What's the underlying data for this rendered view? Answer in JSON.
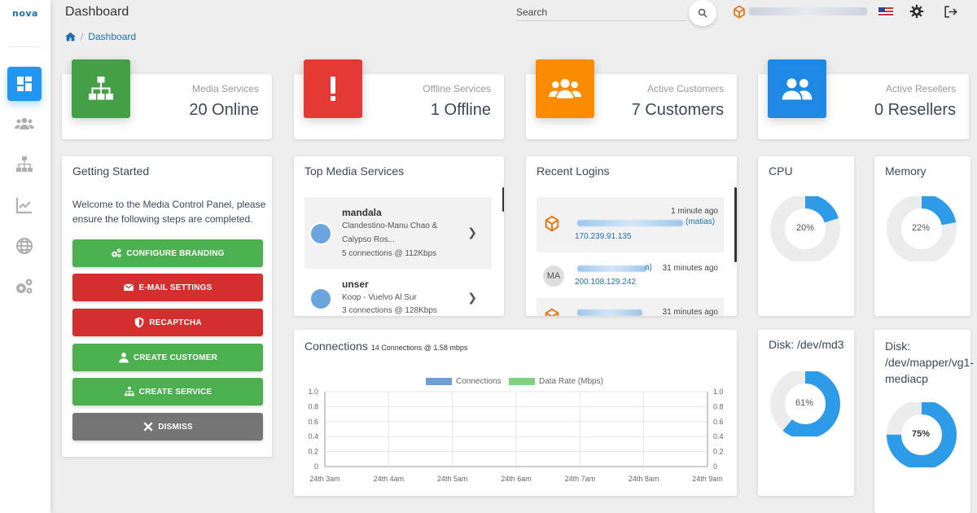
{
  "app": {
    "logo": "nova",
    "page_title": "Dashboard"
  },
  "breadcrumb": {
    "home_icon": "home-icon",
    "current": "Dashboard"
  },
  "header": {
    "search_placeholder": "Search",
    "icons": [
      "search-icon",
      "user-icon",
      "flag-us-icon",
      "gear-icon",
      "logout-icon"
    ]
  },
  "sidebar": {
    "items": [
      {
        "icon": "dashboard-icon",
        "active": true
      },
      {
        "icon": "users-icon",
        "active": false
      },
      {
        "icon": "sitemap-icon",
        "active": false
      },
      {
        "icon": "chart-icon",
        "active": false
      },
      {
        "icon": "globe-icon",
        "active": false
      },
      {
        "icon": "gears-icon",
        "active": false
      }
    ]
  },
  "stats": [
    {
      "label": "Media Services",
      "value": "20 Online",
      "color": "#43a047",
      "icon": "sitemap-icon"
    },
    {
      "label": "Offline Services",
      "value": "1 Offline",
      "color": "#e53935",
      "icon": "exclamation-icon"
    },
    {
      "label": "Active Customers",
      "value": "7 Customers",
      "color": "#fb8c00",
      "icon": "users-icon"
    },
    {
      "label": "Active Resellers",
      "value": "0 Resellers",
      "color": "#1e88e5",
      "icon": "user-group-icon"
    }
  ],
  "getting_started": {
    "title": "Getting Started",
    "text": "Welcome to the Media Control Panel, please ensure the following steps are completed.",
    "buttons": [
      {
        "label": "CONFIGURE BRANDING",
        "color": "#4caf50",
        "icon": "gears-icon"
      },
      {
        "label": "E-MAIL SETTINGS",
        "color": "#d32f2f",
        "icon": "envelope-icon"
      },
      {
        "label": "RECAPTCHA",
        "color": "#d32f2f",
        "icon": "shield-icon"
      },
      {
        "label": "CREATE CUSTOMER",
        "color": "#4caf50",
        "icon": "user-icon"
      },
      {
        "label": "CREATE SERVICE",
        "color": "#4caf50",
        "icon": "sitemap-icon"
      },
      {
        "label": "DISMISS",
        "color": "#757575",
        "icon": "times-icon"
      }
    ]
  },
  "top_media": {
    "title": "Top Media Services",
    "items": [
      {
        "name": "mandala",
        "track_line1": "Clandestino-Manu Chao &",
        "track_line2": "Calypso Ros...",
        "stats": "5 connections @ 112Kbps"
      },
      {
        "name": "unser",
        "track_line1": "Koop - Vuelvo Al Sur",
        "track_line2": "",
        "stats": "3 connections @ 128Kbps"
      }
    ]
  },
  "recent_logins": {
    "title": "Recent Logins",
    "items": [
      {
        "time": "1 minute ago",
        "user_suffix": "(matias)",
        "ip": "170.239.91.135",
        "avatar": "box-icon"
      },
      {
        "time": "31 minutes ago",
        "user_suffix": "a)",
        "ip": "200.108.129.242",
        "avatar": "MA"
      },
      {
        "time": "31 minutes ago",
        "user_suffix": "",
        "ip": "",
        "avatar": "box-icon"
      }
    ]
  },
  "resources": [
    {
      "title": "CPU",
      "percent": 20,
      "label": "20%"
    },
    {
      "title": "Memory",
      "percent": 22,
      "label": "22%"
    },
    {
      "title": "Disk: /dev/md3",
      "percent": 61,
      "label": "61%"
    },
    {
      "title_lines": [
        "Disk:",
        "/dev/mapper/vg1-",
        "mediacp"
      ],
      "percent": 75,
      "label": "75%"
    }
  ],
  "connections": {
    "title": "Connections",
    "subtitle": "14 Connections @ 1.58 mbps"
  },
  "chart_data": {
    "type": "line",
    "categories": [
      "24th 3am",
      "24th 4am",
      "24th 5am",
      "24th 6am",
      "24th 7am",
      "24th 8am",
      "24th 9am"
    ],
    "series": [
      {
        "name": "Connections",
        "color": "#6f9fd8",
        "values": []
      },
      {
        "name": "Data Rate (Mbps)",
        "color": "#7fd07f",
        "values": []
      }
    ],
    "y_ticks": [
      "1.0",
      "0.8",
      "0.6",
      "0.4",
      "0.2",
      "0"
    ],
    "ylim": [
      0,
      1
    ],
    "y2_ticks": [
      "1.0",
      "0.8",
      "0.6",
      "0.4",
      "0.2",
      "0"
    ],
    "legend": "top",
    "grid": true
  }
}
